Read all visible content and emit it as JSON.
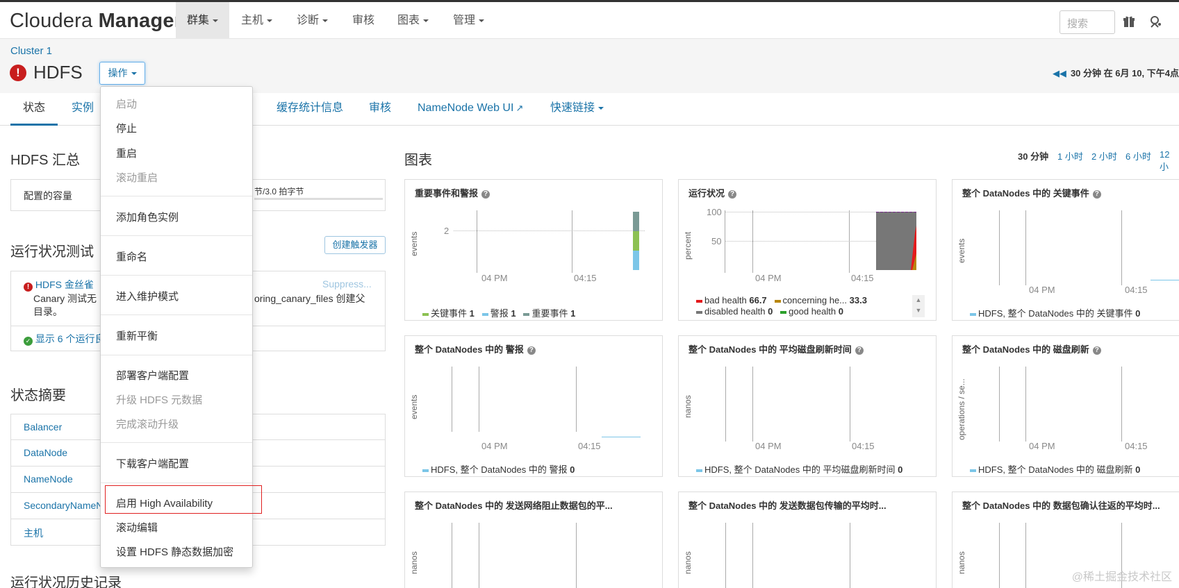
{
  "brand": {
    "part1": "Cloudera",
    "part2": "Manager"
  },
  "nav": {
    "items": [
      {
        "label": "群集",
        "caret": true,
        "active": true
      },
      {
        "label": "主机",
        "caret": true
      },
      {
        "label": "诊断",
        "caret": true
      },
      {
        "label": "审核",
        "caret": false
      },
      {
        "label": "图表",
        "caret": true
      },
      {
        "label": "管理",
        "caret": true
      }
    ],
    "search_placeholder": "搜索"
  },
  "header": {
    "cluster": "Cluster 1",
    "service": "HDFS",
    "ops_button": "操作",
    "time_note": "30 分钟 在 6月 10, 下午4点"
  },
  "tabs": [
    "状态",
    "实例",
    "缓存统计信息",
    "审核",
    "NameNode Web UI",
    "快速链接"
  ],
  "summary": {
    "title": "HDFS 汇总",
    "capacity_label": "配置的容量",
    "capacity_value": "节/3.0 拍字节"
  },
  "health": {
    "title": "运行状况测试",
    "create_trigger": "创建触发器",
    "alert_name": "HDFS 金丝雀",
    "suppress": "Suppress...",
    "alert_text_1": "Canary 测试无",
    "alert_text_2": "oring_canary_files 创建父",
    "alert_text_3": "目录。",
    "show_more": "显示 6 个运行良"
  },
  "status_summary": {
    "title": "状态摘要",
    "rows": [
      "Balancer",
      "DataNode",
      "NameNode",
      "SecondaryNameN",
      "主机"
    ]
  },
  "history_title": "运行状况历史记录",
  "charts": {
    "title": "图表",
    "ranges": [
      "30 分钟",
      "1 小时",
      "2 小时",
      "6 小时",
      "12 小"
    ],
    "cards": [
      {
        "title": "重要事件和警报",
        "ylabel": "events",
        "ytick": "2",
        "x1": "04 PM",
        "x2": "04:15",
        "legend": [
          {
            "name": "关键事件",
            "value": "1",
            "color": "#8cc152"
          },
          {
            "name": "警报",
            "value": "1",
            "color": "#7cc6e8"
          },
          {
            "name": "重要事件",
            "value": "1",
            "color": "#7a9a95"
          }
        ]
      },
      {
        "title": "运行状况",
        "ylabel": "percent",
        "ytick1": "100",
        "ytick2": "50",
        "x1": "04 PM",
        "x2": "04:15",
        "legend": [
          {
            "name": "bad health",
            "value": "66.7",
            "color": "#e41a1c"
          },
          {
            "name": "concerning he...",
            "value": "33.3",
            "color": "#b8860b"
          },
          {
            "name": "disabled health",
            "value": "0",
            "color": "#777777"
          },
          {
            "name": "good health",
            "value": "0",
            "color": "#2ca02c"
          }
        ]
      },
      {
        "title": "整个 DataNodes 中的 关键事件",
        "ylabel": "events",
        "x1": "04 PM",
        "x2": "04:15",
        "legend": [
          {
            "name": "HDFS, 整个 DataNodes 中的 关键事件",
            "value": "0",
            "color": "#7cc6e8"
          }
        ]
      },
      {
        "title": "整个 DataNodes 中的 警报",
        "ylabel": "events",
        "x1": "04 PM",
        "x2": "04:15",
        "legend": [
          {
            "name": "HDFS, 整个 DataNodes 中的 警报",
            "value": "0",
            "color": "#7cc6e8"
          }
        ]
      },
      {
        "title": "整个 DataNodes 中的 平均磁盘刷新时间",
        "ylabel": "nanos",
        "x1": "04 PM",
        "x2": "04:15",
        "legend": [
          {
            "name": "HDFS, 整个 DataNodes 中的 平均磁盘刷新时间",
            "value": "0",
            "color": "#7cc6e8"
          }
        ]
      },
      {
        "title": "整个 DataNodes 中的 磁盘刷新",
        "ylabel": "operations / se...",
        "x1": "04 PM",
        "x2": "04:15",
        "legend": [
          {
            "name": "HDFS, 整个 DataNodes 中的 磁盘刷新",
            "value": "0",
            "color": "#7cc6e8"
          }
        ]
      },
      {
        "title": "整个 DataNodes 中的 发送网络阻止数据包的平...",
        "ylabel": "nanos"
      },
      {
        "title": "整个 DataNodes 中的 发送数据包传输的平均时...",
        "ylabel": "nanos"
      },
      {
        "title": "整个 DataNodes 中的 数据包确认往返的平均时...",
        "ylabel": "nanos"
      }
    ]
  },
  "menu": {
    "items": [
      {
        "label": "启动",
        "disabled": true
      },
      {
        "label": "停止",
        "disabled": false
      },
      {
        "label": "重启",
        "disabled": false
      },
      {
        "label": "滚动重启",
        "disabled": true
      },
      {
        "label": "添加角色实例",
        "disabled": false
      },
      {
        "label": "重命名",
        "disabled": false
      },
      {
        "label": "进入维护模式",
        "disabled": false
      },
      {
        "label": "重新平衡",
        "disabled": false
      },
      {
        "label": "部署客户端配置",
        "disabled": false
      },
      {
        "label": "升级 HDFS 元数据",
        "disabled": true
      },
      {
        "label": "完成滚动升级",
        "disabled": true
      },
      {
        "label": "下载客户端配置",
        "disabled": false
      },
      {
        "label": "启用 High Availability",
        "disabled": false,
        "highlighted": true
      },
      {
        "label": "滚动编辑",
        "disabled": false
      },
      {
        "label": "设置 HDFS 静态数据加密",
        "disabled": false
      }
    ]
  },
  "watermark": "@稀土掘金技术社区"
}
